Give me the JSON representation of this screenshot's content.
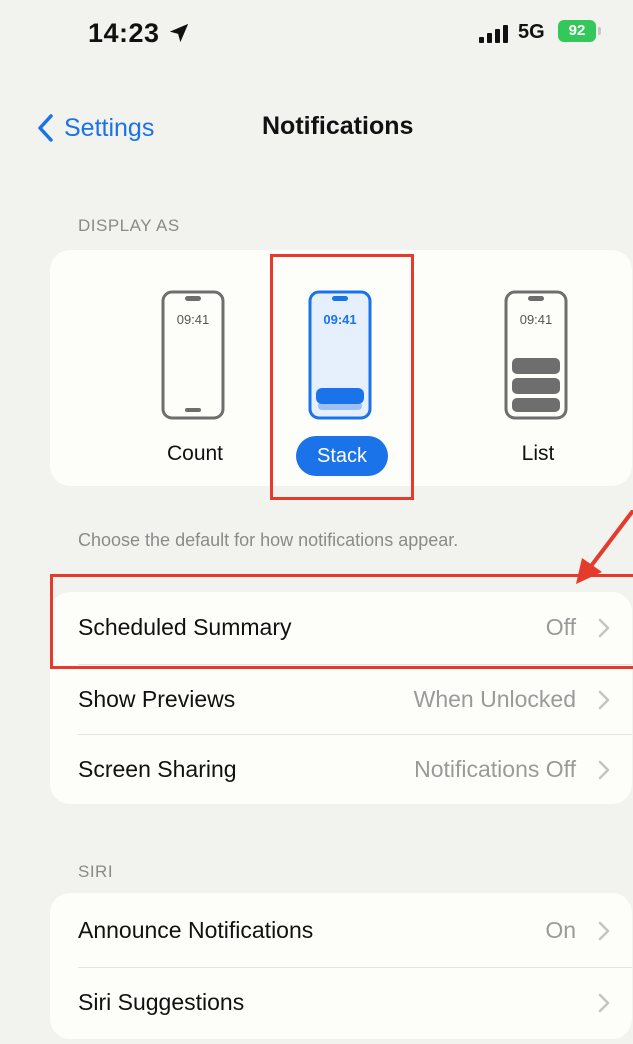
{
  "status_bar": {
    "time": "14:23",
    "network": "5G",
    "battery": "92"
  },
  "nav": {
    "back_label": "Settings",
    "title": "Notifications"
  },
  "display_as": {
    "header": "DISPLAY AS",
    "options": [
      {
        "label": "Count",
        "time": "09:41",
        "selected": false
      },
      {
        "label": "Stack",
        "time": "09:41",
        "selected": true
      },
      {
        "label": "List",
        "time": "09:41",
        "selected": false
      }
    ],
    "footer": "Choose the default for how notifications appear."
  },
  "settings_rows": [
    {
      "label": "Scheduled Summary",
      "value": "Off"
    },
    {
      "label": "Show Previews",
      "value": "When Unlocked"
    },
    {
      "label": "Screen Sharing",
      "value": "Notifications Off"
    }
  ],
  "siri": {
    "header": "SIRI",
    "rows": [
      {
        "label": "Announce Notifications",
        "value": "On"
      },
      {
        "label": "Siri Suggestions",
        "value": ""
      }
    ]
  },
  "colors": {
    "accent": "#1a73e8",
    "highlight": "#e53b2c",
    "battery": "#34c759",
    "background": "#f2f2ee"
  },
  "icons": [
    "location-arrow-icon",
    "cellular-signal-icon",
    "battery-icon",
    "chevron-left-icon",
    "chevron-right-icon",
    "phone-count-icon",
    "phone-stack-icon",
    "phone-list-icon",
    "red-arrow-annotation"
  ]
}
